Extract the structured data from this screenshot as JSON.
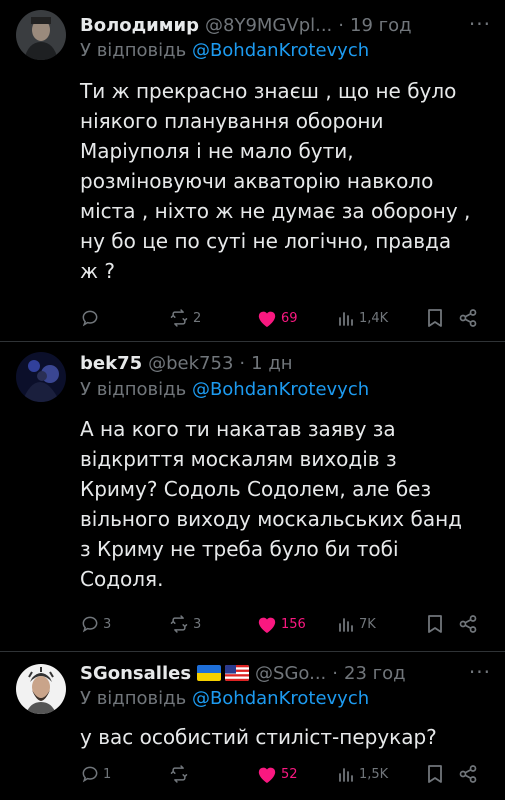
{
  "tweets": [
    {
      "name": "Володимир",
      "handle": "@8Y9MGVpl...",
      "time": "19 год",
      "reply_prefix": "У відповідь",
      "reply_to": "@BohdanKrotevych",
      "body": "Ти ж прекрасно знаєш , що не було\nніякого планування оборони\nМаріуполя і не мало бути,\nрозміновуючи акваторію навколо\nміста , ніхто ж не думає за оборону ,\nну бо це по суті не логічно, правда\nж ?",
      "reply_count": "",
      "retweet_count": "2",
      "like_count": "69",
      "view_count": "1,4K",
      "colors": {
        "like": "#f91880",
        "muted": "#71767b"
      }
    },
    {
      "name": "bek75",
      "handle": "@bek753",
      "time": "1 дн",
      "reply_prefix": "У відповідь",
      "reply_to": "@BohdanKrotevych",
      "body": "А на кого ти накатав заяву за\nвідкриття москалям виходів з\nКриму? Содоль Содолем, але без\nвільного виходу москальських банд\nз Криму не треба було би тобі\nСодоля.",
      "reply_count": "3",
      "retweet_count": "3",
      "like_count": "156",
      "view_count": "7K"
    },
    {
      "name": "SGonsalles",
      "flags": [
        "ukraine-flag-icon",
        "us-flag-icon"
      ],
      "handle": "@SGo...",
      "time": "23 год",
      "reply_prefix": "У відповідь",
      "reply_to": "@BohdanKrotevych",
      "body": "у вас особистий стиліст-перукар?",
      "reply_count": "1",
      "retweet_count": "",
      "like_count": "52",
      "view_count": "1,5K"
    }
  ]
}
